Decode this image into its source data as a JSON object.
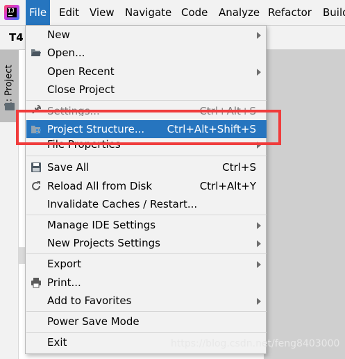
{
  "menubar": {
    "logo_text": "IJ",
    "items": [
      {
        "label": "File",
        "active": true
      },
      {
        "label": "Edit"
      },
      {
        "label": "View"
      },
      {
        "label": "Navigate"
      },
      {
        "label": "Code"
      },
      {
        "label": "Analyze"
      },
      {
        "label": "Refactor"
      },
      {
        "label": "Build"
      }
    ]
  },
  "editor": {
    "tab_label": "T4",
    "project_tool": "1: Project"
  },
  "file_menu": {
    "ghost_settings": "Settings...",
    "ghost_settings_shortcut": "Ctrl+Alt+S",
    "items": [
      {
        "label": "New",
        "submenu": true
      },
      {
        "label": "Open...",
        "icon": "folder-open-icon"
      },
      {
        "label": "Open Recent",
        "submenu": true
      },
      {
        "label": "Close Project"
      },
      {
        "label": "Project Structure...",
        "shortcut": "Ctrl+Alt+Shift+S",
        "highlighted": true,
        "icon": "project-structure-icon"
      },
      {
        "label": "File Properties",
        "submenu": true
      },
      {
        "label": "Save All",
        "shortcut": "Ctrl+S",
        "icon": "save-icon"
      },
      {
        "label": "Reload All from Disk",
        "shortcut": "Ctrl+Alt+Y",
        "icon": "reload-icon"
      },
      {
        "label": "Invalidate Caches / Restart..."
      },
      {
        "label": "Manage IDE Settings",
        "submenu": true
      },
      {
        "label": "New Projects Settings",
        "submenu": true
      },
      {
        "label": "Export",
        "submenu": true
      },
      {
        "label": "Print...",
        "icon": "print-icon"
      },
      {
        "label": "Add to Favorites",
        "submenu": true
      },
      {
        "label": "Power Save Mode"
      },
      {
        "label": "Exit"
      }
    ]
  },
  "watermark": "https://blog.csdn.net/feng8403000",
  "colors": {
    "highlight": "#2675bf",
    "annotation_red": "#f03c3c",
    "menu_bg": "#f2f2f2"
  }
}
